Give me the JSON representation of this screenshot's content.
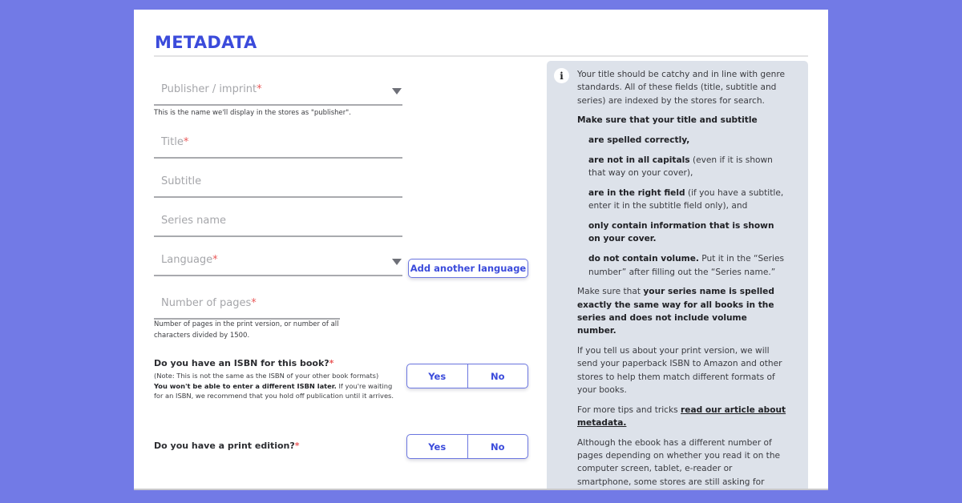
{
  "section": {
    "title": "METADATA"
  },
  "fields": {
    "publisher": {
      "label": "Publisher / imprint",
      "required_mark": "*",
      "hint": "This is the name we'll display in the stores as \"publisher\"."
    },
    "title": {
      "label": "Title",
      "required_mark": "*"
    },
    "subtitle": {
      "label": "Subtitle"
    },
    "series_name": {
      "label": "Series name"
    },
    "language": {
      "label": "Language",
      "required_mark": "*",
      "add_button": "Add another language"
    },
    "pages": {
      "label": "Number of pages",
      "required_mark": "*",
      "hint_line1": "Number of pages in the print version, or number of all",
      "hint_line2": "characters divided by 1500."
    }
  },
  "isbn_question": {
    "label": "Do you have an ISBN for this book?",
    "required_mark": "*",
    "note_line1": "(Note: This is not the same as the ISBN of your other book formats)",
    "note_bold": "You won't be able to enter a different ISBN later.",
    "note_rest": " If you're waiting for an ISBN, we recommend that you hold off publication until it arrives.",
    "yes": "Yes",
    "no": "No"
  },
  "print_question": {
    "label": "Do you have a print edition?",
    "required_mark": "*",
    "yes": "Yes",
    "no": "No"
  },
  "help_panel": {
    "icon": "info-icon",
    "intro": "Your title should be catchy and in line with genre standards. All of these fields (title, subtitle and series) are indexed by the stores for search.",
    "make_sure_heading": "Make sure that your title and subtitle",
    "rules": [
      {
        "bold": "are spelled correctly,",
        "rest": ""
      },
      {
        "bold": "are not in all capitals",
        "rest": " (even if it is shown that way on your cover),"
      },
      {
        "bold": "are in the right field",
        "rest": " (if you have a subtitle, enter it in the subtitle field only), and"
      },
      {
        "bold": "only contain information that is shown on your cover.",
        "rest": ""
      },
      {
        "bold": "do not contain volume.",
        "rest": " Put it in the “Series number” after filling out the “Series name.”"
      }
    ],
    "series_prefix": "Make sure that ",
    "series_bold": "your series name is spelled exactly the same way for all books in the series and does not include volume number.",
    "print_info": "If you tell us about your print version, we will send your paperback ISBN to Amazon and other stores to help them match different formats of your books.",
    "tips_prefix": "For more tips and tricks ",
    "tips_link": "read our article about metadata.",
    "ebook_pages": "Although the ebook has a different number of pages depending on whether you read it on the computer screen, tablet, e-reader or smartphone, some stores are still asking for"
  }
}
